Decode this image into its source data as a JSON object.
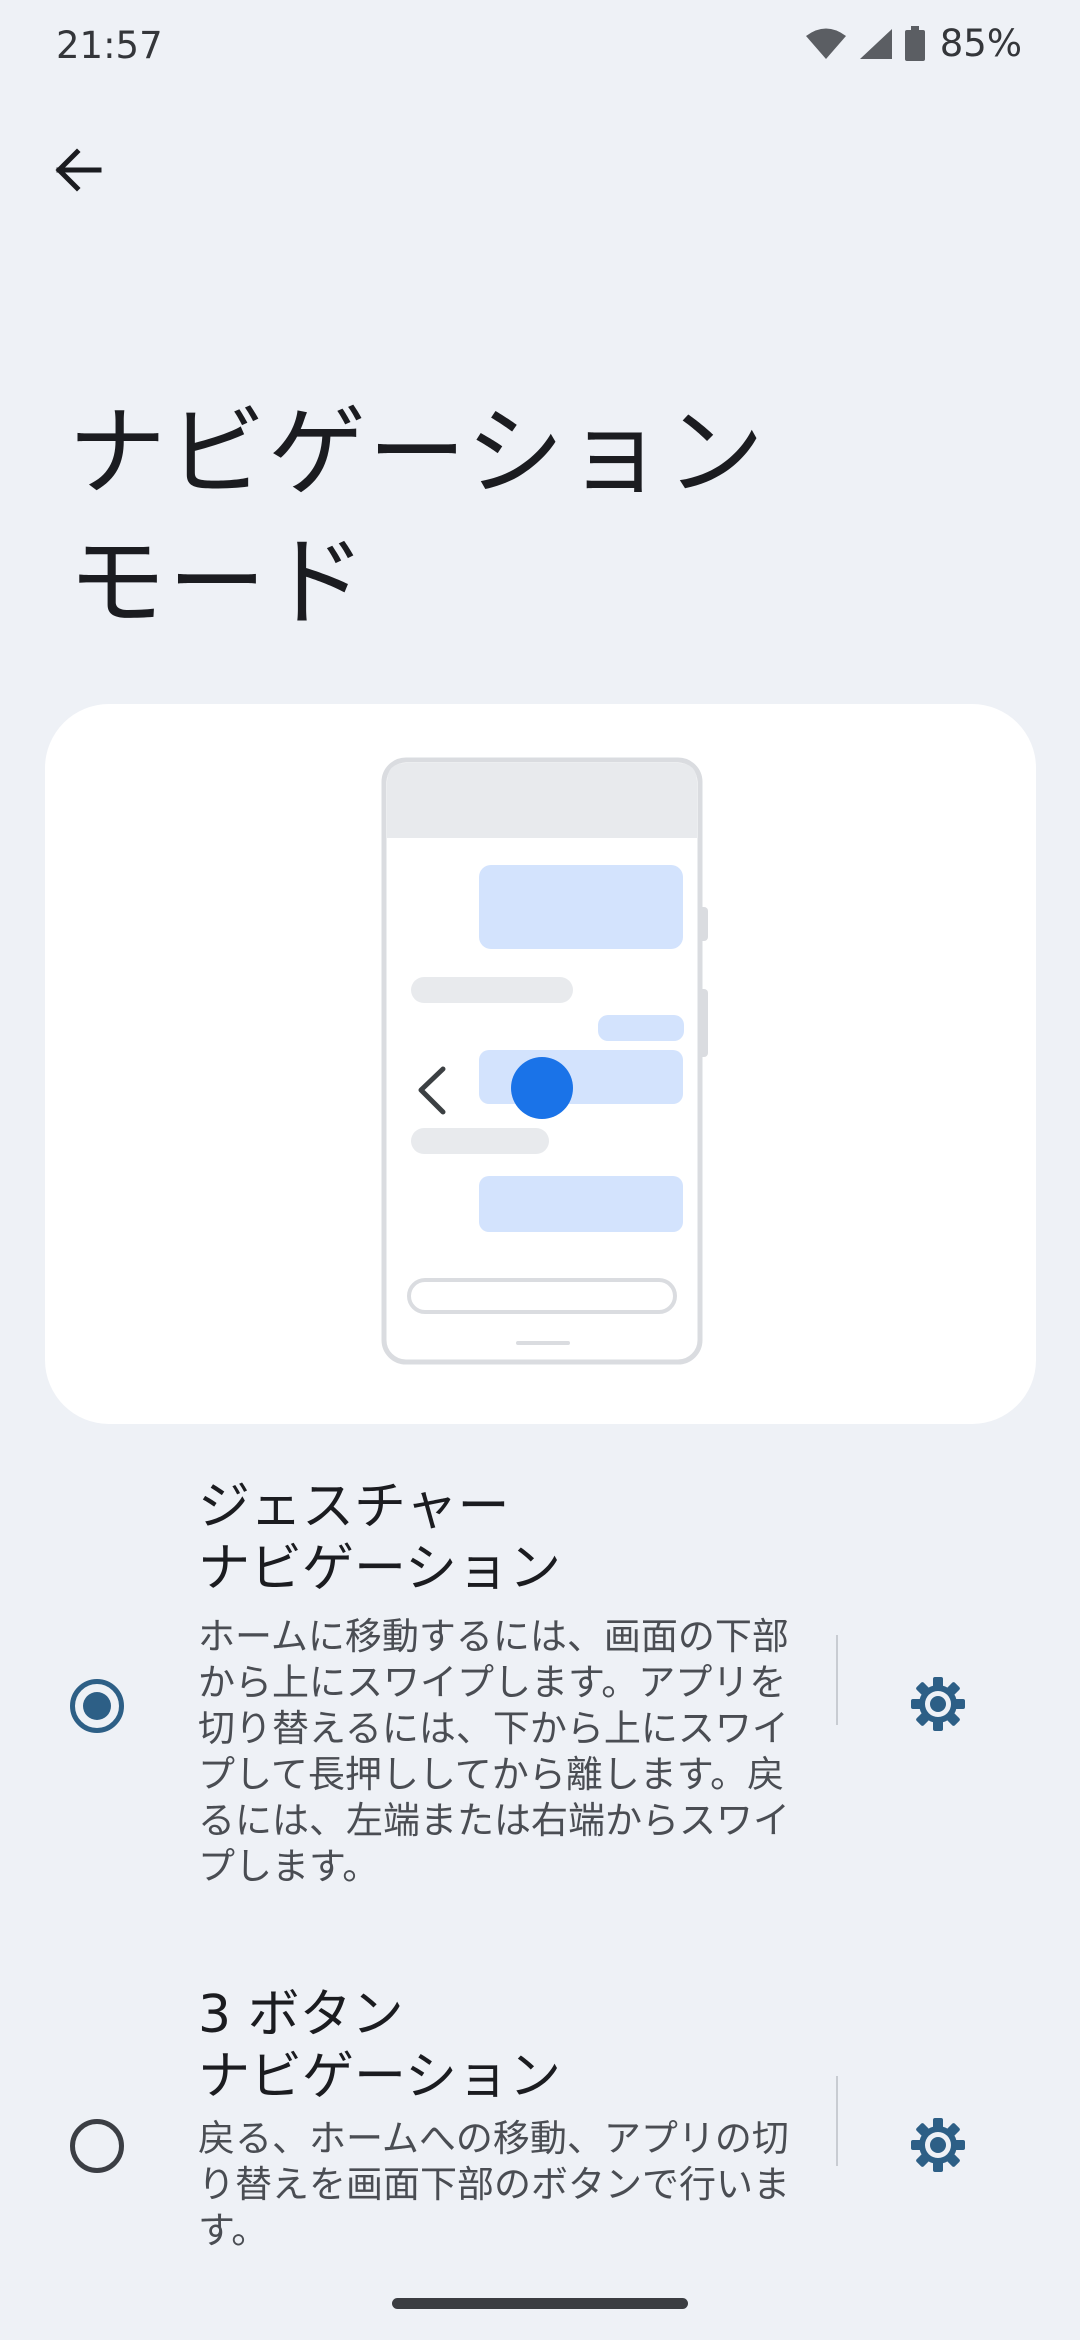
{
  "status_bar": {
    "time": "21:57",
    "battery_percent": "85%",
    "icons": [
      "wifi-icon",
      "cell-signal-icon",
      "battery-icon"
    ]
  },
  "header": {
    "back_icon": "arrow-back-icon",
    "title": "ナビゲーション\nモード"
  },
  "illustration": {
    "description_icon": "phone-gesture-illustration",
    "accent_color": "#1a73e8",
    "bubble_color": "#d3e3fd"
  },
  "options": [
    {
      "title": "ジェスチャー\nナビゲーション",
      "description": "ホームに移動するには、画面の下部から上にスワイプします。アプリを切り替えるには、下から上にスワイプして長押ししてから離します。戻るには、左端または右端からスワイプします。",
      "selected": true,
      "settings_icon": "gear-icon"
    },
    {
      "title": "3 ボタン\nナビゲーション",
      "description": "戻る、ホームへの移動、アプリの切り替えを画面下部のボタンで行います。",
      "selected": false,
      "settings_icon": "gear-icon"
    }
  ],
  "colors": {
    "background": "#eef1f6",
    "primary": "#2d5f86"
  }
}
